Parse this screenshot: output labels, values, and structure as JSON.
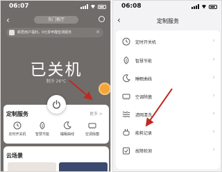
{
  "left_screen": {
    "time": "06:07",
    "room_name": "东门客厅",
    "banner_text": "新居用户福利，0元享甲醛检测服务",
    "status_title": "已关机",
    "status_sub": "制冷 26°C",
    "service_card": {
      "title": "定制服务",
      "more_label": "更多 >",
      "items": [
        {
          "label": "定时开关机",
          "icon": "timer-icon"
        },
        {
          "label": "智慧节能",
          "icon": "leaf-icon"
        },
        {
          "label": "睡眠曲线",
          "icon": "moon-icon"
        },
        {
          "label": "空调除菌",
          "icon": "sterilize-icon"
        }
      ]
    },
    "scene_card": {
      "title": "云场景"
    }
  },
  "right_screen": {
    "time": "06:08",
    "title": "定制服务",
    "rows": [
      {
        "label": "定时开关机",
        "icon": "timer-icon"
      },
      {
        "label": "智慧节能",
        "icon": "leaf-icon"
      },
      {
        "label": "睡眠曲线",
        "icon": "moon-icon"
      },
      {
        "label": "空调除菌",
        "icon": "sterilize-icon"
      },
      {
        "label": "滤网清洗",
        "icon": "filter-icon"
      },
      {
        "label": "能耗记录",
        "icon": "plug-icon"
      },
      {
        "label": "故障检测",
        "icon": "diagnosis-icon"
      }
    ]
  },
  "colors": {
    "device_bg": "#6f6c6a",
    "annotation_arrow": "#c0281f",
    "badge": "#f2a63a"
  }
}
